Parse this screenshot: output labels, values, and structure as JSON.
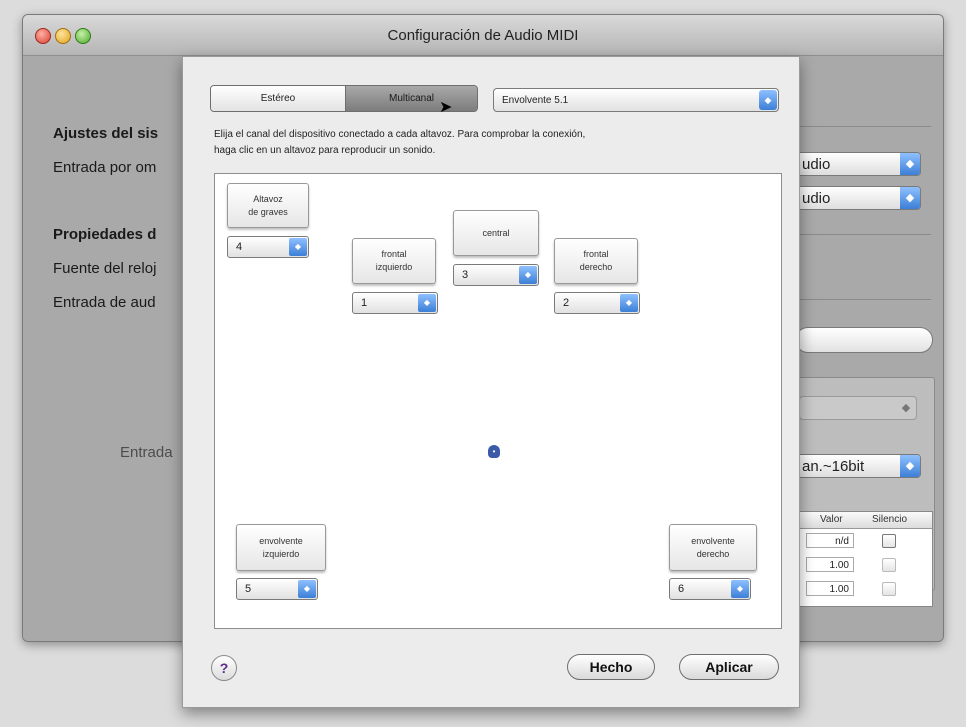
{
  "window": {
    "title": "Configuración de Audio MIDI",
    "left_labels": {
      "system_settings": "Ajustes del sis",
      "default_input": "Entrada por om",
      "properties": "Propiedades d",
      "clock_source": "Fuente del reloj",
      "audio_input": "Entrada de aud",
      "entrada": "Entrada"
    },
    "right_selects": {
      "sel1": "udio",
      "sel2": "udio",
      "sel3": "",
      "format": "an.~16bit"
    },
    "search_field": "",
    "table": {
      "headers": [
        "Valor",
        "Silencio"
      ],
      "rows": [
        {
          "value": "n/d"
        },
        {
          "value": "1.00"
        },
        {
          "value": "1.00"
        }
      ]
    }
  },
  "sheet": {
    "segment": {
      "stereo": "Estéreo",
      "multichannel": "Multicanal"
    },
    "config_popup": "Envolvente 5.1",
    "instructions_line1": "Elija el canal del dispositivo conectado a cada altavoz. Para comprobar la conexión,",
    "instructions_line2": "haga clic en un altavoz para reproducir un sonido.",
    "speakers": {
      "subwoofer": {
        "label": "Altavoz\nde graves",
        "channel": "4"
      },
      "front_left": {
        "label": "frontal\nizquierdo",
        "channel": "1"
      },
      "center": {
        "label": "central",
        "channel": "3"
      },
      "front_right": {
        "label": "frontal\nderecho",
        "channel": "2"
      },
      "surround_left": {
        "label": "envolvente\nizquierdo",
        "channel": "5"
      },
      "surround_right": {
        "label": "envolvente\nderecho",
        "channel": "6"
      }
    },
    "help": "?",
    "done_button": "Hecho",
    "apply_button": "Aplicar"
  },
  "colors": {
    "accent": "#3c7fd6",
    "selected_segment": "#8a8a8a"
  }
}
